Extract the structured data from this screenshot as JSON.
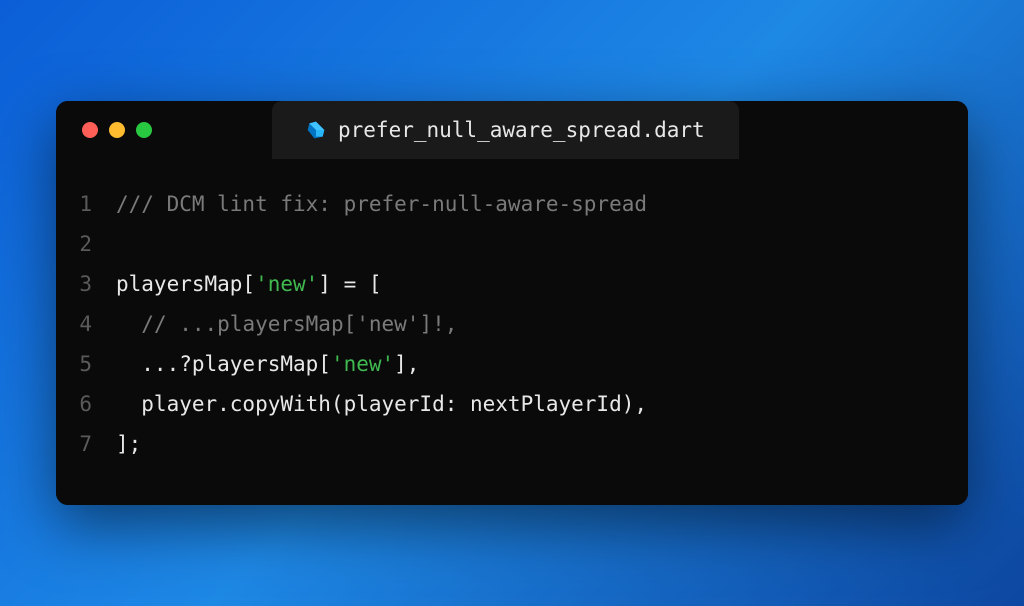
{
  "tab": {
    "filename": "prefer_null_aware_spread.dart",
    "icon": "dart-icon"
  },
  "code": {
    "lines": [
      {
        "num": "1",
        "tokens": [
          {
            "cls": "tok-comment",
            "t": "/// DCM lint fix: prefer-null-aware-spread"
          }
        ]
      },
      {
        "num": "2",
        "tokens": [
          {
            "cls": "tok-ident",
            "t": ""
          }
        ]
      },
      {
        "num": "3",
        "tokens": [
          {
            "cls": "tok-ident",
            "t": "playersMap["
          },
          {
            "cls": "tok-string",
            "t": "'new'"
          },
          {
            "cls": "tok-ident",
            "t": "] = ["
          }
        ]
      },
      {
        "num": "4",
        "tokens": [
          {
            "cls": "tok-ident",
            "t": "  "
          },
          {
            "cls": "tok-comment",
            "t": "// ...playersMap['new']!,"
          }
        ]
      },
      {
        "num": "5",
        "tokens": [
          {
            "cls": "tok-ident",
            "t": "  ...?playersMap["
          },
          {
            "cls": "tok-string",
            "t": "'new'"
          },
          {
            "cls": "tok-ident",
            "t": "],"
          }
        ]
      },
      {
        "num": "6",
        "tokens": [
          {
            "cls": "tok-ident",
            "t": "  player.copyWith(playerId: nextPlayerId),"
          }
        ]
      },
      {
        "num": "7",
        "tokens": [
          {
            "cls": "tok-ident",
            "t": "];"
          }
        ]
      }
    ]
  }
}
